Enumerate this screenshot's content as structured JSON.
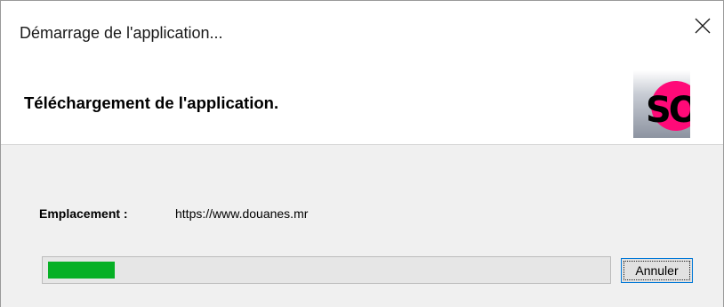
{
  "window": {
    "title": "Démarrage de l'application..."
  },
  "header": {
    "title": "Téléchargement de l'application.",
    "logo_text": "SO"
  },
  "location": {
    "label": "Emplacement :",
    "value": "https://www.douanes.mr"
  },
  "progress": {
    "value_percent": 12,
    "color": "#06b025"
  },
  "buttons": {
    "cancel_label": "Annuler"
  },
  "icons": {
    "close": "close-icon",
    "logo": "app-logo"
  }
}
